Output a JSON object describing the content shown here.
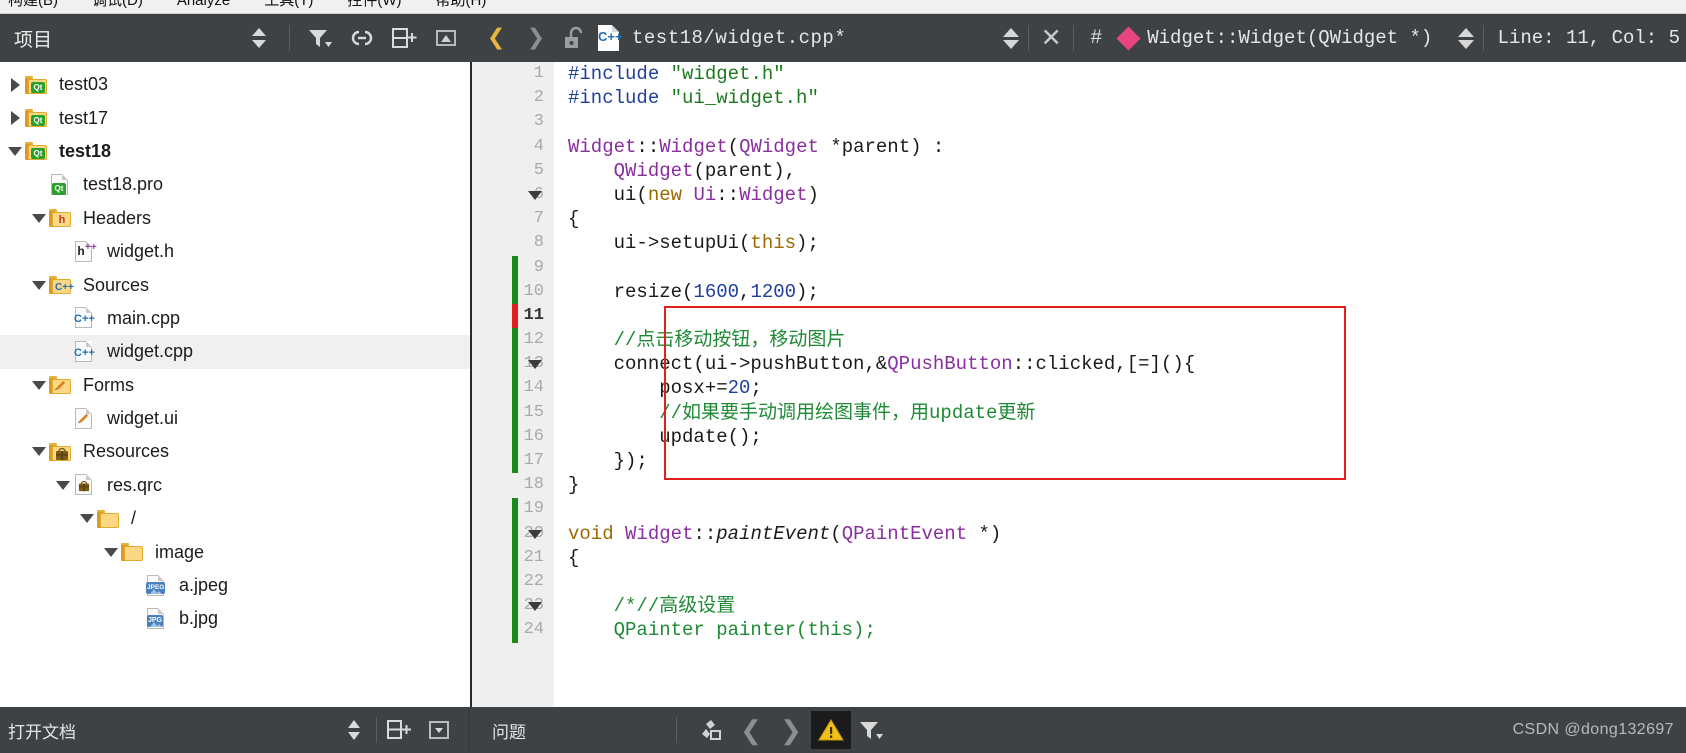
{
  "menubar": {
    "items": [
      "构建(B)",
      "调试(D)",
      "Analyze",
      "工具(T)",
      "控件(W)",
      "帮助(H)"
    ]
  },
  "sidebar": {
    "title": "项目",
    "tools": [
      {
        "name": "sync-updown-icon",
        "label": "同步"
      },
      {
        "name": "filter-icon",
        "label": "过滤"
      },
      {
        "name": "link-icon",
        "label": "链接"
      },
      {
        "name": "split-add-icon",
        "label": "分栏"
      },
      {
        "name": "minimize-panel-icon",
        "label": "最小化"
      }
    ],
    "tree": [
      {
        "label": "test03",
        "indent": 0,
        "arrow": "right",
        "icon": "folder-qt"
      },
      {
        "label": "test17",
        "indent": 0,
        "arrow": "right",
        "icon": "folder-qt"
      },
      {
        "label": "test18",
        "indent": 0,
        "arrow": "down",
        "icon": "folder-qt",
        "bold": true
      },
      {
        "label": "test18.pro",
        "indent": 1,
        "arrow": "none",
        "icon": "file-qt"
      },
      {
        "label": "Headers",
        "indent": 1,
        "arrow": "down",
        "icon": "folder-h"
      },
      {
        "label": "widget.h",
        "indent": 2,
        "arrow": "none",
        "icon": "file-h"
      },
      {
        "label": "Sources",
        "indent": 1,
        "arrow": "down",
        "icon": "folder-cpp"
      },
      {
        "label": "main.cpp",
        "indent": 2,
        "arrow": "none",
        "icon": "file-cpp"
      },
      {
        "label": "widget.cpp",
        "indent": 2,
        "arrow": "none",
        "icon": "file-cpp",
        "selected": true
      },
      {
        "label": "Forms",
        "indent": 1,
        "arrow": "down",
        "icon": "folder-form"
      },
      {
        "label": "widget.ui",
        "indent": 2,
        "arrow": "none",
        "icon": "file-form"
      },
      {
        "label": "Resources",
        "indent": 1,
        "arrow": "down",
        "icon": "folder-res"
      },
      {
        "label": "res.qrc",
        "indent": 2,
        "arrow": "down",
        "icon": "file-res"
      },
      {
        "label": "/",
        "indent": 3,
        "arrow": "down",
        "icon": "folder-plain"
      },
      {
        "label": "image",
        "indent": 4,
        "arrow": "down",
        "icon": "folder-plain"
      },
      {
        "label": "a.jpeg",
        "indent": 5,
        "arrow": "none",
        "icon": "file-jpeg"
      },
      {
        "label": "b.jpg",
        "indent": 5,
        "arrow": "none",
        "icon": "file-jpg"
      }
    ]
  },
  "editor_toolbar": {
    "back_label": "❮",
    "forward_label": "❯",
    "lock_name": "unlocked-padlock-icon",
    "file_path": "test18/widget.cpp*",
    "file_icon_label": "C++",
    "close_label": "✕",
    "hash_label": "#",
    "symbol": "Widget::Widget(QWidget *)",
    "symbol_marker_color": "#e8447d",
    "line_col": "Line: 11, Col: 5"
  },
  "code": {
    "cursor_line": 11,
    "fold_lines": [
      6,
      13,
      20,
      23
    ],
    "change_marker_color": "#1a8a1a",
    "cursor_marker_color": "#e02020",
    "highlight_box_color": "#e02020",
    "lines": [
      {
        "n": 1,
        "html": "<span class=\"pre\">#include</span> <span class=\"str\">\"widget.h\"</span>"
      },
      {
        "n": 2,
        "html": "<span class=\"pre\">#include</span> <span class=\"str\">\"ui_widget.h\"</span>"
      },
      {
        "n": 3,
        "html": ""
      },
      {
        "n": 4,
        "html": "<span class=\"k\">Widget</span>::<span class=\"k\">Widget</span>(<span class=\"k\">QWidget</span> *parent) :"
      },
      {
        "n": 5,
        "html": "    <span class=\"k\">QWidget</span>(parent),"
      },
      {
        "n": 6,
        "html": "    ui(<span class=\"kw\">new</span> <span class=\"k\">Ui</span>::<span class=\"k\">Widget</span>)"
      },
      {
        "n": 7,
        "html": "{"
      },
      {
        "n": 8,
        "html": "    ui-&gt;setupUi(<span class=\"kw\">this</span>);"
      },
      {
        "n": 9,
        "html": ""
      },
      {
        "n": 10,
        "html": "    resize(<span class=\"num\">1600</span>,<span class=\"num\">1200</span>);"
      },
      {
        "n": 11,
        "html": ""
      },
      {
        "n": 12,
        "html": "    <span class=\"cmt\">//点击移动按钮，移动图片</span>"
      },
      {
        "n": 13,
        "html": "    connect(ui-&gt;pushButton,&amp;<span class=\"k\">QPushButton</span>::clicked,[=](){"
      },
      {
        "n": 14,
        "html": "        posx+=<span class=\"num\">20</span>;"
      },
      {
        "n": 15,
        "html": "        <span class=\"cmt\">//如果要手动调用绘图事件，用update更新</span>"
      },
      {
        "n": 16,
        "html": "        update();"
      },
      {
        "n": 17,
        "html": "    });"
      },
      {
        "n": 18,
        "html": "}"
      },
      {
        "n": 19,
        "html": ""
      },
      {
        "n": 20,
        "html": "<span class=\"vo\">void</span> <span class=\"k\">Widget</span>::<span class=\"ital\">paintEvent</span>(<span class=\"k\">QPaintEvent</span> *)"
      },
      {
        "n": 21,
        "html": "{"
      },
      {
        "n": 22,
        "html": ""
      },
      {
        "n": 23,
        "html": "    <span class=\"cmt\">/*//高级设置</span>"
      },
      {
        "n": 24,
        "html": "    <span class=\"cmt\">QPainter painter(this);</span>"
      }
    ]
  },
  "bottom_bar": {
    "open_documents_label": "打开文档",
    "issues_label": "问题",
    "watermark": "CSDN @dong132697",
    "left_tools": [
      {
        "name": "sync-updown-icon"
      },
      {
        "name": "split-add-icon"
      },
      {
        "name": "dropdown-box-icon"
      }
    ],
    "right_tools": [
      {
        "name": "clear-issues-icon"
      },
      {
        "name": "prev-issue-icon"
      },
      {
        "name": "next-issue-icon"
      },
      {
        "name": "warning-filter-icon"
      },
      {
        "name": "filter-icon"
      }
    ]
  }
}
